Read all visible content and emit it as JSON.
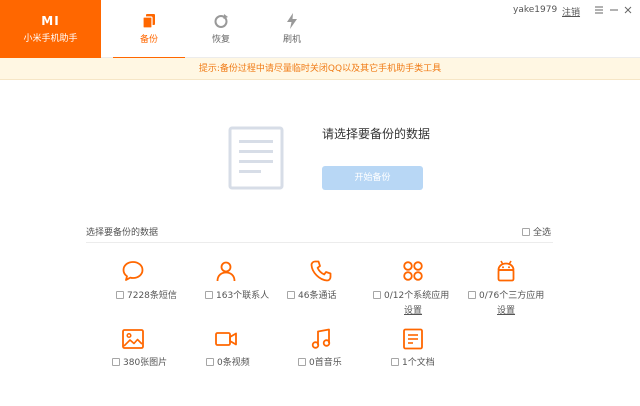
{
  "brand": {
    "logo": "MI",
    "label": "小米手机助手"
  },
  "tabs": [
    {
      "label": "备份",
      "icon": "backup-icon",
      "active": true
    },
    {
      "label": "恢复",
      "icon": "restore-icon",
      "active": false
    },
    {
      "label": "刷机",
      "icon": "flash-icon",
      "active": false
    }
  ],
  "window": {
    "username": "yake1979",
    "logout_label": "注销"
  },
  "notice": {
    "text": "提示:备份过程中请尽量临时关闭QQ以及其它手机助手类工具"
  },
  "hero": {
    "title": "请选择要备份的数据",
    "start_button": "开始备份"
  },
  "section": {
    "title": "选择要备份的数据",
    "select_all_label": "全选"
  },
  "items": [
    {
      "label": "7228条短信",
      "icon": "message-icon"
    },
    {
      "label": "163个联系人",
      "icon": "contact-icon"
    },
    {
      "label": "46条通话",
      "icon": "phone-icon"
    },
    {
      "label": "0/12个系统应用",
      "icon": "system-apps-icon",
      "link": "设置"
    },
    {
      "label": "0/76个三方应用",
      "icon": "android-icon",
      "link": "设置"
    },
    {
      "label": "380张图片",
      "icon": "image-icon"
    },
    {
      "label": "0条视频",
      "icon": "video-icon"
    },
    {
      "label": "0首音乐",
      "icon": "music-icon"
    },
    {
      "label": "1个文档",
      "icon": "document-icon"
    }
  ],
  "colors": {
    "accent": "#ff6700",
    "primary_disabled": "#b8d7f5",
    "notice_text": "#f07b16",
    "notice_bg": "#fff7e3"
  }
}
